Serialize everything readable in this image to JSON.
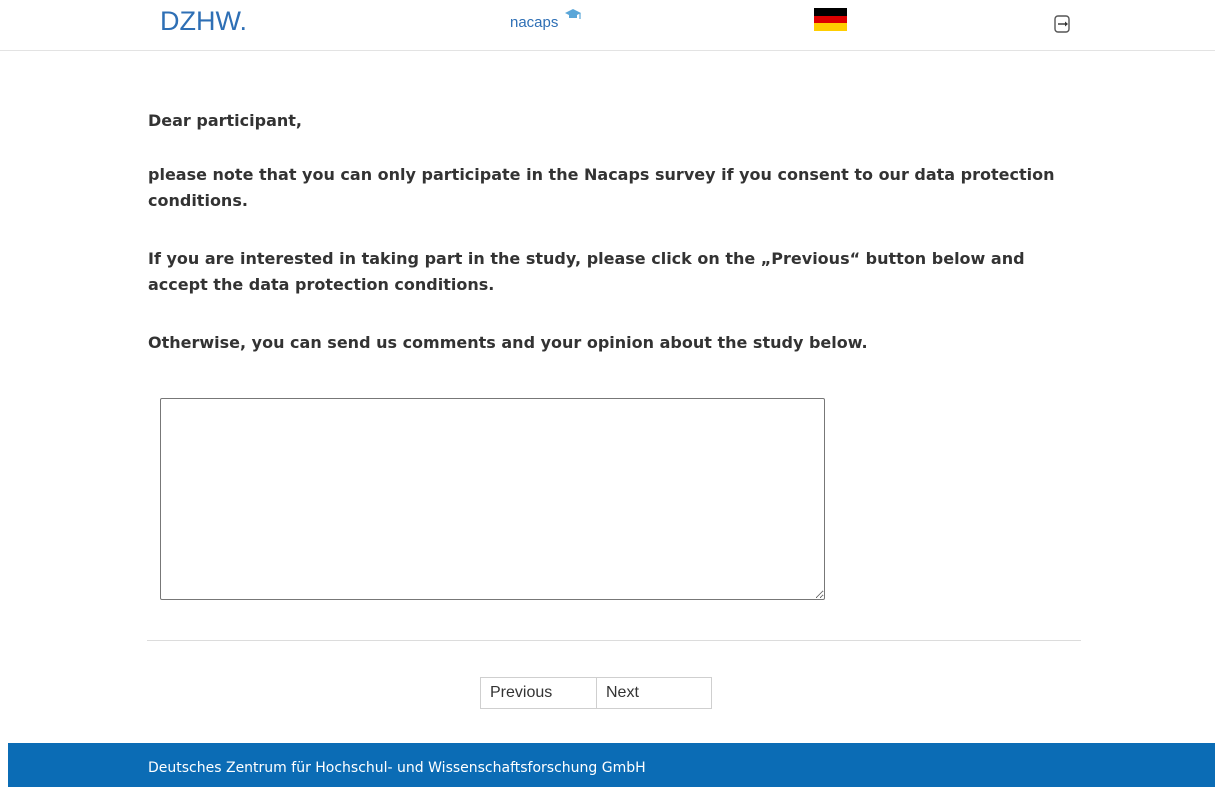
{
  "header": {
    "logo_dzhw": "DZHW.",
    "logo_nacaps": "nacaps",
    "language_flag": "german-flag-icon",
    "logout_icon": "logout-icon"
  },
  "content": {
    "greeting": "Dear participant,",
    "paragraph_consent": "please note that you can only participate in the Nacaps survey if you consent to our data protection conditions.",
    "paragraph_previous": "If you are interested in taking part in the study, please click on the „Previous“ button below and accept the data protection conditions.",
    "paragraph_comments": "Otherwise, you can send us comments and your opinion about the study below."
  },
  "comment_box": {
    "value": "",
    "placeholder": ""
  },
  "navigation": {
    "previous_label": "Previous",
    "next_label": "Next"
  },
  "footer": {
    "text": "Deutsches Zentrum für Hochschul- und Wissenschaftsforschung GmbH"
  },
  "colors": {
    "brand_blue": "#2e6fb5",
    "footer_blue": "#0b6cb5",
    "flag_black": "#000000",
    "flag_red": "#dd0000",
    "flag_gold": "#ffce00"
  }
}
